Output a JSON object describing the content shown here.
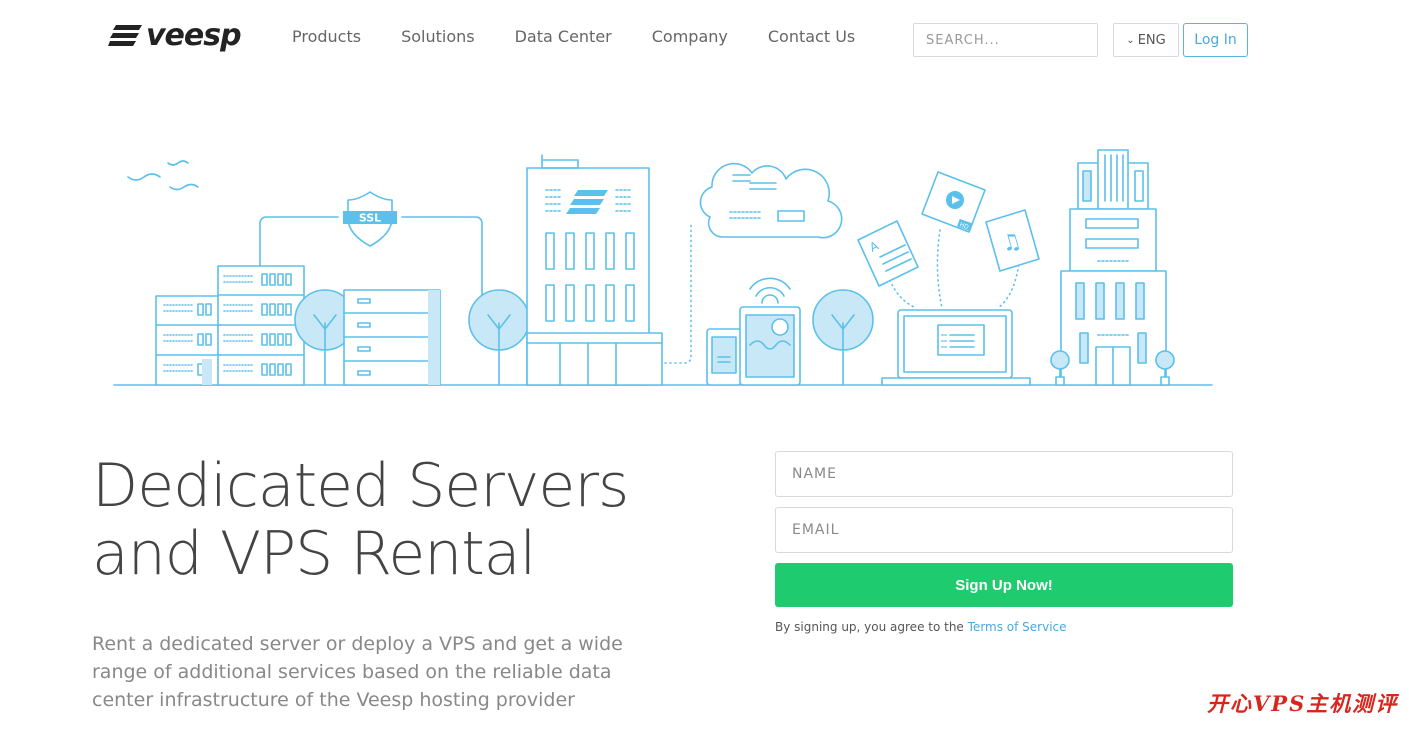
{
  "header": {
    "logo_text": "veesp",
    "nav": [
      "Products",
      "Solutions",
      "Data Center",
      "Company",
      "Contact Us"
    ],
    "search_placeholder": "SEARCH...",
    "language": "ENG",
    "login_label": "Log In"
  },
  "illustration": {
    "ssl_label": "SSL",
    "doc_letter": "A",
    "hd_label": "HD"
  },
  "hero": {
    "title_line1": "Dedicated Servers",
    "title_line2": "and VPS Rental",
    "description": "Rent a dedicated server or deploy a VPS and get a wide range of additional services based on the reliable data center infrastructure of the Veesp hosting provider"
  },
  "form": {
    "name_placeholder": "NAME",
    "email_placeholder": "EMAIL",
    "submit_label": "Sign Up Now!",
    "terms_prefix": "By signing up, you agree to the ",
    "terms_link": "Terms of Service"
  },
  "watermark": "开心VPS主机测评",
  "colors": {
    "accent_blue": "#4aa9dc",
    "line_blue": "#5bc0eb",
    "fill_blue": "#c9e8f7",
    "signup_green": "#1ecb6f",
    "watermark_red": "#d9261c"
  }
}
